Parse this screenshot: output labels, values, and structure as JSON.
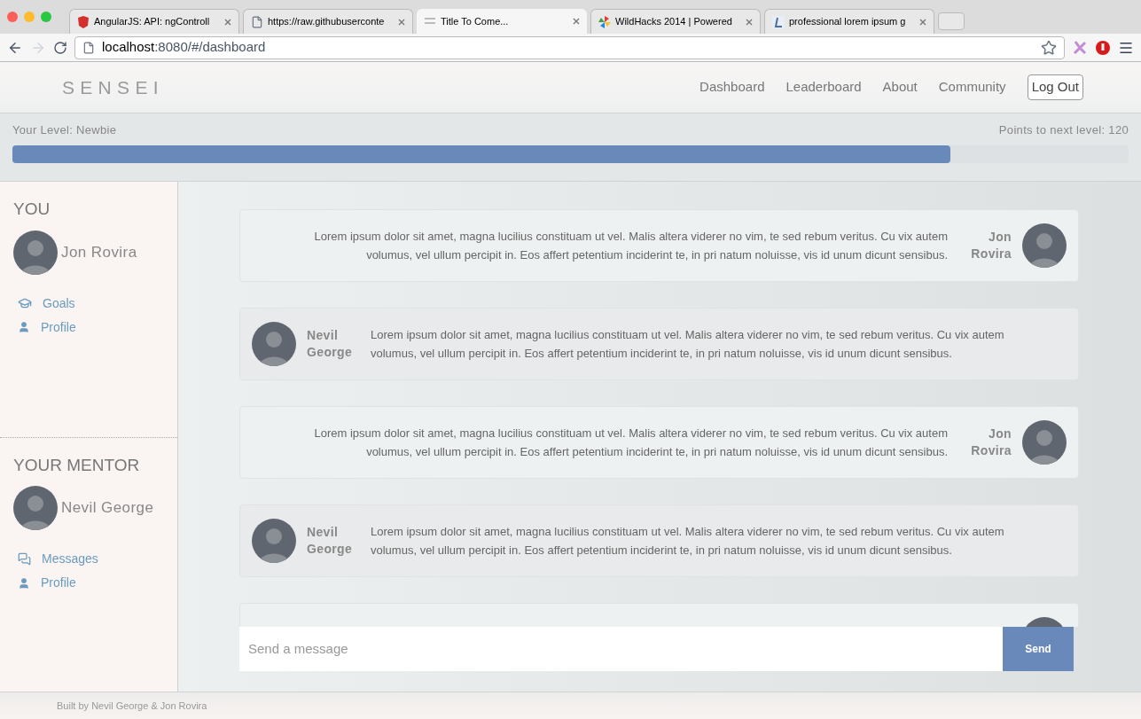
{
  "browser": {
    "tabs": [
      {
        "title": "AngularJS: API: ngControll",
        "selected": false
      },
      {
        "title": "https://raw.githubuserconte",
        "selected": false
      },
      {
        "title": "Title To Come...",
        "selected": true
      },
      {
        "title": "WildHacks 2014 | Powered",
        "selected": false
      },
      {
        "title": "professional lorem ipsum g",
        "selected": false
      }
    ],
    "url_host": "localhost",
    "url_rest": ":8080/#/dashboard"
  },
  "nav": {
    "brand": "SENSEI",
    "links": [
      "Dashboard",
      "Leaderboard",
      "About",
      "Community"
    ],
    "logout": "Log Out"
  },
  "level": {
    "label": "Your Level: Newbie",
    "points": "Points to next level: 120",
    "level": 0.84
  },
  "sidebar": [
    {
      "heading": "YOU",
      "name": "Jon Rovira",
      "links": [
        "Goals",
        "Profile"
      ]
    },
    {
      "heading": "YOUR MENTOR",
      "name": "Nevil George",
      "links": [
        "Messages",
        "Profile"
      ]
    }
  ],
  "messages": [
    {
      "kind": "outgoing",
      "author": "Jon Rovira",
      "text": "Lorem ipsum dolor sit amet, magna lucilius constituam ut vel. Malis altera viderer no vim, te sed rebum veritus. Cu vix autem volumus, vel ullum percipit in. Eos affert petentium inciderint te, in pri natum noluisse, vis id unum dicunt sensibus."
    },
    {
      "kind": "incoming",
      "author": "Nevil George",
      "text": "Lorem ipsum dolor sit amet, magna lucilius constituam ut vel. Malis altera viderer no vim, te sed rebum veritus. Cu vix autem volumus, vel ullum percipit in. Eos affert petentium inciderint te, in pri natum noluisse, vis id unum dicunt sensibus."
    },
    {
      "kind": "outgoing",
      "author": "Jon Rovira",
      "text": "Lorem ipsum dolor sit amet, magna lucilius constituam ut vel. Malis altera viderer no vim, te sed rebum veritus. Cu vix autem volumus, vel ullum percipit in. Eos affert petentium inciderint te, in pri natum noluisse, vis id unum dicunt sensibus."
    },
    {
      "kind": "incoming",
      "author": "Nevil George",
      "text": "Lorem ipsum dolor sit amet, magna lucilius constituam ut vel. Malis altera viderer no vim, te sed rebum veritus. Cu vix autem volumus, vel ullum percipit in. Eos affert petentium inciderint te, in pri natum noluisse, vis id unum dicunt sensibus."
    },
    {
      "kind": "outgoing"
    }
  ],
  "composer": {
    "placeholder": "Send a message",
    "button": "Send"
  },
  "footer": "Built by Nevil George & Jon Rovira"
}
